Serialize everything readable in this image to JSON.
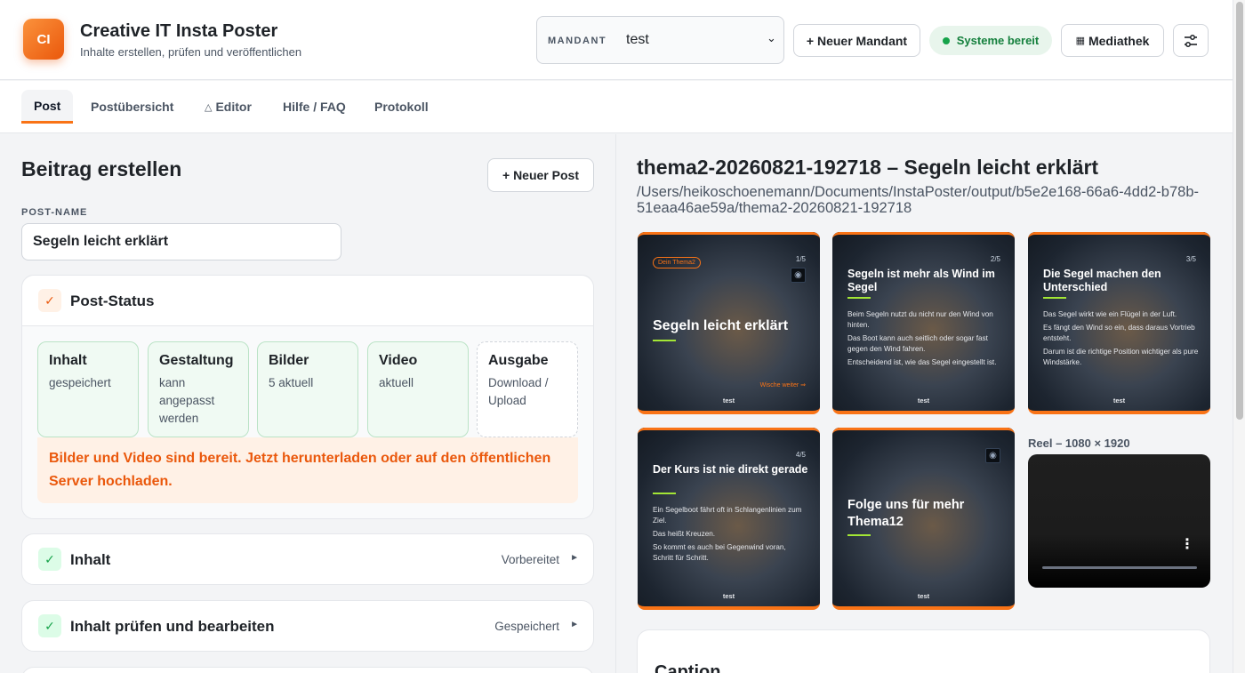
{
  "app": {
    "logo": "CI",
    "title": "Creative IT Insta Poster",
    "subtitle": "Inhalte erstellen, prüfen und veröffentlichen"
  },
  "header": {
    "mandant_label": "MANDANT",
    "mandant_value": "test",
    "new_mandant": "+ Neuer Mandant",
    "status": "Systeme bereit",
    "media": "Mediathek"
  },
  "tabs": [
    "Post",
    "Postübersicht",
    "Editor",
    "Hilfe / FAQ",
    "Protokoll"
  ],
  "left": {
    "title": "Beitrag erstellen",
    "new_post": "+ Neuer Post",
    "post_name_label": "POST-NAME",
    "post_name_value": "Segeln leicht erklärt",
    "status_title": "Post-Status",
    "stages": [
      {
        "title": "Inhalt",
        "sub": "gespeichert"
      },
      {
        "title": "Gestaltung",
        "sub": "kann angepasst werden"
      },
      {
        "title": "Bilder",
        "sub": "5 aktuell"
      },
      {
        "title": "Video",
        "sub": "aktuell"
      },
      {
        "title": "Ausgabe",
        "sub": "Download / Upload"
      }
    ],
    "alert": "Bilder und Video sind bereit. Jetzt herunterladen oder auf den öffentlichen Server hochladen.",
    "sections": [
      {
        "title": "Inhalt",
        "status": "Vorbereitet"
      },
      {
        "title": "Inhalt prüfen und bearbeiten",
        "status": "Gespeichert"
      }
    ]
  },
  "right": {
    "title": "thema2-20260821-192718 – Segeln leicht erklärt",
    "path": "/Users/heikoschoenemann/Documents/InstaPoster/output/b5e2e168-66a6-4dd2-b78b-51eaa46ae59a/thema2-20260821-192718",
    "slides": [
      {
        "num": "1/5",
        "tag": "Dein Thema2",
        "head": "Segeln leicht erklärt",
        "more": "Wische weiter ⇒",
        "foot": "test",
        "body": []
      },
      {
        "num": "2/5",
        "head": "Segeln ist mehr als Wind im Segel",
        "foot": "test",
        "body": [
          "Beim Segeln nutzt du nicht nur den Wind von hinten.",
          "Das Boot kann auch seitlich oder sogar fast gegen den Wind fahren.",
          "Entscheidend ist, wie das Segel eingestellt ist."
        ]
      },
      {
        "num": "3/5",
        "head": "Die Segel machen den Unterschied",
        "foot": "test",
        "body": [
          "Das Segel wirkt wie ein Flügel in der Luft.",
          "Es fängt den Wind so ein, dass daraus Vortrieb entsteht.",
          "Darum ist die richtige Position wichtiger als pure Windstärke."
        ]
      },
      {
        "num": "4/5",
        "head": "Der Kurs ist nie direkt gerade",
        "foot": "test",
        "body": [
          "Ein Segelboot fährt oft in Schlangenlinien zum Ziel.",
          "Das heißt Kreuzen.",
          "So kommt es auch bei Gegenwind voran, Schritt für Schritt."
        ]
      },
      {
        "num": "",
        "head": "Folge uns für mehr Thema12",
        "foot": "test",
        "body": []
      }
    ],
    "reel_label": "Reel – 1080 × 1920",
    "caption_title": "Caption"
  }
}
